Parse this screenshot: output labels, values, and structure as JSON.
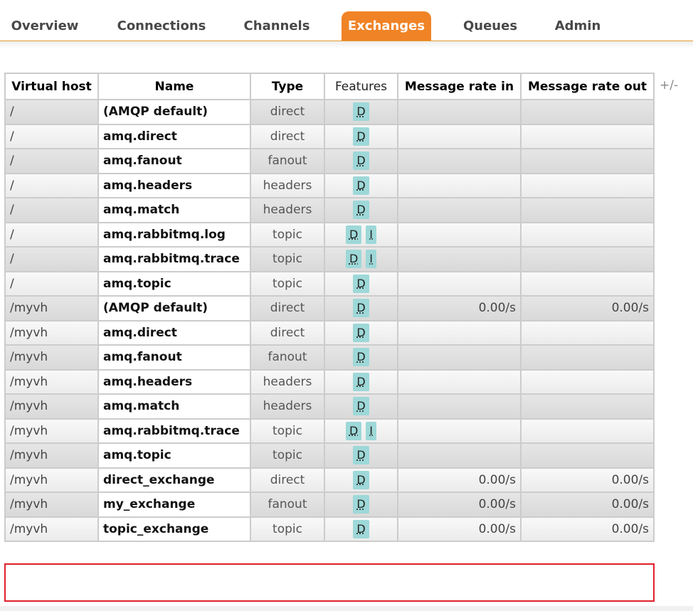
{
  "nav": {
    "tabs": [
      {
        "label": "Overview",
        "active": false
      },
      {
        "label": "Connections",
        "active": false
      },
      {
        "label": "Channels",
        "active": false
      },
      {
        "label": "Exchanges",
        "active": true
      },
      {
        "label": "Queues",
        "active": false
      },
      {
        "label": "Admin",
        "active": false
      }
    ]
  },
  "table": {
    "headers": {
      "vhost": "Virtual host",
      "name": "Name",
      "type": "Type",
      "features": "Features",
      "rate_in": "Message rate in",
      "rate_out": "Message rate out"
    },
    "toggle_columns": "+/-",
    "rows": [
      {
        "vhost": "/",
        "name": "(AMQP default)",
        "type": "direct",
        "features": [
          "D"
        ],
        "rate_in": "",
        "rate_out": ""
      },
      {
        "vhost": "/",
        "name": "amq.direct",
        "type": "direct",
        "features": [
          "D"
        ],
        "rate_in": "",
        "rate_out": ""
      },
      {
        "vhost": "/",
        "name": "amq.fanout",
        "type": "fanout",
        "features": [
          "D"
        ],
        "rate_in": "",
        "rate_out": ""
      },
      {
        "vhost": "/",
        "name": "amq.headers",
        "type": "headers",
        "features": [
          "D"
        ],
        "rate_in": "",
        "rate_out": ""
      },
      {
        "vhost": "/",
        "name": "amq.match",
        "type": "headers",
        "features": [
          "D"
        ],
        "rate_in": "",
        "rate_out": ""
      },
      {
        "vhost": "/",
        "name": "amq.rabbitmq.log",
        "type": "topic",
        "features": [
          "D",
          "I"
        ],
        "rate_in": "",
        "rate_out": ""
      },
      {
        "vhost": "/",
        "name": "amq.rabbitmq.trace",
        "type": "topic",
        "features": [
          "D",
          "I"
        ],
        "rate_in": "",
        "rate_out": ""
      },
      {
        "vhost": "/",
        "name": "amq.topic",
        "type": "topic",
        "features": [
          "D"
        ],
        "rate_in": "",
        "rate_out": ""
      },
      {
        "vhost": "/myvh",
        "name": "(AMQP default)",
        "type": "direct",
        "features": [
          "D"
        ],
        "rate_in": "0.00/s",
        "rate_out": "0.00/s"
      },
      {
        "vhost": "/myvh",
        "name": "amq.direct",
        "type": "direct",
        "features": [
          "D"
        ],
        "rate_in": "",
        "rate_out": ""
      },
      {
        "vhost": "/myvh",
        "name": "amq.fanout",
        "type": "fanout",
        "features": [
          "D"
        ],
        "rate_in": "",
        "rate_out": ""
      },
      {
        "vhost": "/myvh",
        "name": "amq.headers",
        "type": "headers",
        "features": [
          "D"
        ],
        "rate_in": "",
        "rate_out": ""
      },
      {
        "vhost": "/myvh",
        "name": "amq.match",
        "type": "headers",
        "features": [
          "D"
        ],
        "rate_in": "",
        "rate_out": ""
      },
      {
        "vhost": "/myvh",
        "name": "amq.rabbitmq.trace",
        "type": "topic",
        "features": [
          "D",
          "I"
        ],
        "rate_in": "",
        "rate_out": ""
      },
      {
        "vhost": "/myvh",
        "name": "amq.topic",
        "type": "topic",
        "features": [
          "D"
        ],
        "rate_in": "",
        "rate_out": ""
      },
      {
        "vhost": "/myvh",
        "name": "direct_exchange",
        "type": "direct",
        "features": [
          "D"
        ],
        "rate_in": "0.00/s",
        "rate_out": "0.00/s"
      },
      {
        "vhost": "/myvh",
        "name": "my_exchange",
        "type": "fanout",
        "features": [
          "D"
        ],
        "rate_in": "0.00/s",
        "rate_out": "0.00/s"
      },
      {
        "vhost": "/myvh",
        "name": "topic_exchange",
        "type": "topic",
        "features": [
          "D"
        ],
        "rate_in": "0.00/s",
        "rate_out": "0.00/s",
        "highlighted": true
      }
    ]
  },
  "colors": {
    "accent": "#f08326",
    "badge": "#9ed8d8",
    "highlight": "#e0202a"
  }
}
